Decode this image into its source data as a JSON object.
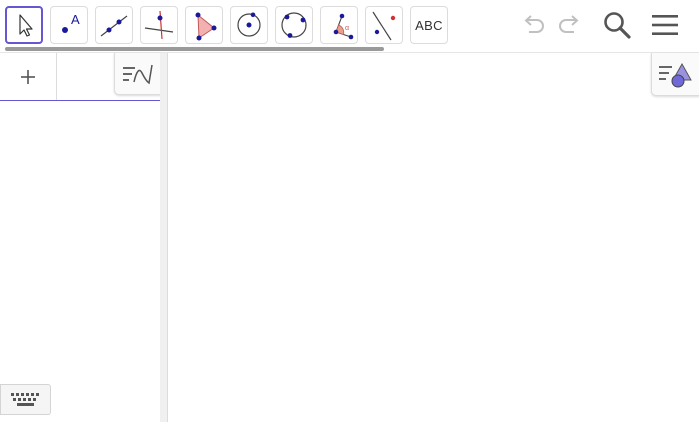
{
  "toolbar": {
    "tools": [
      {
        "id": "move",
        "icon": "move-arrow-icon",
        "selected": true
      },
      {
        "id": "point",
        "icon": "point-icon",
        "glyph": "A"
      },
      {
        "id": "line",
        "icon": "line-icon"
      },
      {
        "id": "perpendicular",
        "icon": "perpendicular-line-icon"
      },
      {
        "id": "polygon",
        "icon": "polygon-icon"
      },
      {
        "id": "circle",
        "icon": "circle-center-point-icon"
      },
      {
        "id": "circle-three-points",
        "icon": "circle-three-points-icon"
      },
      {
        "id": "angle",
        "icon": "angle-icon",
        "glyph": "α"
      },
      {
        "id": "reflect",
        "icon": "reflect-about-line-icon"
      },
      {
        "id": "text",
        "icon": "text-tool-icon",
        "label": "ABC"
      }
    ],
    "undo": {
      "icon": "undo-icon",
      "enabled": false
    },
    "redo": {
      "icon": "redo-icon",
      "enabled": false
    },
    "search": {
      "icon": "search-icon"
    },
    "menu": {
      "icon": "hamburger-menu-icon"
    }
  },
  "algebra": {
    "input_glyph": "+",
    "menu_icon": "algebra-view-menu-icon"
  },
  "graphics": {
    "style_bar_icon": "graphics-style-bar-icon"
  },
  "keyboard": {
    "icon": "keyboard-icon"
  },
  "colors": {
    "accent": "#6557d2",
    "point": "#1a1a99",
    "polygon_fill": "#f3b0b0",
    "angle_fill": "#e8a08a",
    "disabled": "#c0c0c0",
    "icon_dark": "#555555"
  }
}
